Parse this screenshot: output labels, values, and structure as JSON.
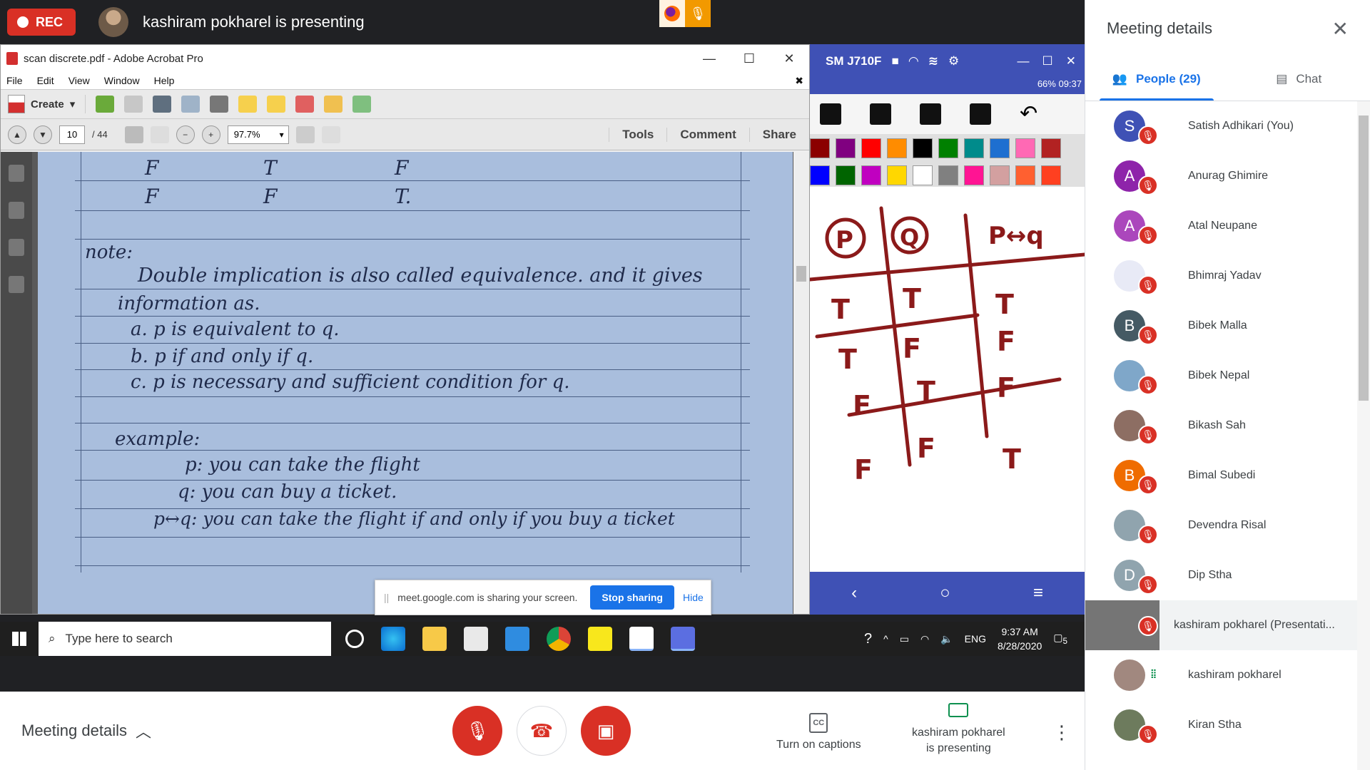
{
  "topbar": {
    "rec_label": "REC",
    "presenting_title": "kashiram pokharel is presenting"
  },
  "acrobat": {
    "window_title": "scan discrete.pdf - Adobe Acrobat Pro",
    "menu": [
      "File",
      "Edit",
      "View",
      "Window",
      "Help"
    ],
    "create_label": "Create",
    "page_current": "10",
    "page_total": "/ 44",
    "zoom": "97.7%",
    "tb_links": [
      "Tools",
      "Comment",
      "Share"
    ],
    "notes": {
      "row1": [
        "F",
        "T",
        "F"
      ],
      "row2": [
        "F",
        "F",
        "T."
      ],
      "note_heading": "note:",
      "note_line1": "Double implication is also called equivalence. and it gives",
      "note_line2": "information as.",
      "item_a": "a. p is equivalent to q.",
      "item_b": "b. p if and only if q.",
      "item_c": "c. p is necessary and sufficient condition for q.",
      "example_heading": "example:",
      "ex_p": "p: you can take the flight",
      "ex_q": "q: you can buy a ticket.",
      "ex_pq": "p↔q: you can take the flight if and only if you buy a ticket"
    }
  },
  "share_banner": {
    "text": "meet.google.com is sharing your screen.",
    "stop_label": "Stop sharing",
    "hide_label": "Hide"
  },
  "phone": {
    "device_name": "SM J710F",
    "status": "66% 09:37",
    "palette_row1": [
      "#8b0000",
      "#800080",
      "#ff0000",
      "#ff8c00",
      "#000000",
      "#008000",
      "#008b8b",
      "#1e6fd0",
      "#ff69b4",
      "#b22222"
    ],
    "palette_row2": [
      "#0000ff",
      "#006400",
      "#c000c0",
      "#ffd700",
      "#ffffff",
      "#808080",
      "#ff1493",
      "#d3a0a0",
      "#ff6030",
      "#ff4020"
    ],
    "board": {
      "headers": [
        "P",
        "Q",
        "P↔q"
      ],
      "rows": [
        [
          "T",
          "T",
          "T"
        ],
        [
          "T",
          "F",
          "F"
        ],
        [
          "F",
          "T",
          "F"
        ],
        [
          "F",
          "F",
          "T"
        ]
      ]
    }
  },
  "taskbar": {
    "search_placeholder": "Type here to search",
    "lang": "ENG",
    "time": "9:37 AM",
    "date": "8/28/2020",
    "notif_count": "5"
  },
  "bottombar": {
    "meeting_details": "Meeting details",
    "captions": "Turn on captions",
    "presenting_line1": "kashiram pokharel",
    "presenting_line2": "is presenting"
  },
  "panel": {
    "title": "Meeting details",
    "people_tab": "People (29)",
    "chat_tab": "Chat",
    "people": [
      {
        "initial": "S",
        "color": "#3f51b5",
        "name": "Satish Adhikari (You)"
      },
      {
        "initial": "A",
        "color": "#8e24aa",
        "name": "Anurag Ghimire"
      },
      {
        "initial": "A",
        "color": "#ab47bc",
        "name": "Atal Neupane"
      },
      {
        "initial": "",
        "color": "#e8eaf6",
        "name": "Bhimraj Yadav"
      },
      {
        "initial": "B",
        "color": "#455a64",
        "name": "Bibek Malla"
      },
      {
        "initial": "",
        "color": "#7fa7c9",
        "name": "Bibek Nepal"
      },
      {
        "initial": "",
        "color": "#8d6e63",
        "name": "Bikash Sah"
      },
      {
        "initial": "B",
        "color": "#ef6c00",
        "name": "Bimal Subedi"
      },
      {
        "initial": "",
        "color": "#90a4ae",
        "name": "Devendra Risal"
      },
      {
        "initial": "D",
        "color": "#90a4ae",
        "name": "Dip Stha"
      },
      {
        "initial": "",
        "color": "#757575",
        "name": "kashiram pokharel (Presentati..."
      },
      {
        "initial": "",
        "color": "#a1887f",
        "name": "kashiram pokharel"
      },
      {
        "initial": "",
        "color": "#6d7b5d",
        "name": "Kiran Stha"
      }
    ]
  }
}
